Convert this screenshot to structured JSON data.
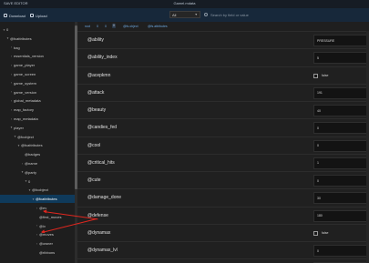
{
  "titlebar": {
    "app_name": "SAVE EDITOR",
    "window_title": "Gamel.mdata"
  },
  "menubar": {
    "download": "Download",
    "upload": "Upload"
  },
  "toolbar": {
    "filter": {
      "value": "All"
    },
    "search": {
      "placeholder": "Search by field or value"
    }
  },
  "breadcrumb": [
    "root",
    "0",
    "0",
    "0",
    "@fs.object",
    "@fs.attributes"
  ],
  "tree": [
    {
      "label": "0",
      "chevron": "v",
      "indent": 0
    },
    {
      "label": "@fcattributes",
      "chevron": "v",
      "indent": 1
    },
    {
      "label": "bag",
      "chevron": ">",
      "indent": 2
    },
    {
      "label": "essentials_version",
      "chevron": ">",
      "indent": 2
    },
    {
      "label": "game_player",
      "chevron": ">",
      "indent": 2
    },
    {
      "label": "game_screen",
      "chevron": ">",
      "indent": 2
    },
    {
      "label": "game_system",
      "chevron": ">",
      "indent": 2
    },
    {
      "label": "game_version",
      "chevron": ">",
      "indent": 2
    },
    {
      "label": "global_metadata",
      "chevron": ">",
      "indent": 2
    },
    {
      "label": "map_factory",
      "chevron": ">",
      "indent": 2
    },
    {
      "label": "map_metadata",
      "chevron": ">",
      "indent": 2
    },
    {
      "label": "player",
      "chevron": "v",
      "indent": 2
    },
    {
      "label": "@fcobject",
      "chevron": "v",
      "indent": 3
    },
    {
      "label": "@fcattributes",
      "chevron": "v",
      "indent": 4
    },
    {
      "label": "@badges",
      "chevron": "",
      "indent": 5
    },
    {
      "label": "@name",
      "chevron": ">",
      "indent": 5
    },
    {
      "label": "@party",
      "chevron": "v",
      "indent": 5
    },
    {
      "label": "0",
      "chevron": "v",
      "indent": 6
    },
    {
      "label": "@fcobject",
      "chevron": "v",
      "indent": 7
    },
    {
      "label": "@fcattributes",
      "chevron": "v",
      "indent": 8,
      "selected": true
    },
    {
      "label": "@ev",
      "chevron": ">",
      "indent": 9
    },
    {
      "label": "@first_moves",
      "chevron": "",
      "indent": 9
    },
    {
      "label": "@iv",
      "chevron": ">",
      "indent": 9
    },
    {
      "label": "@moves",
      "chevron": ">",
      "indent": 9
    },
    {
      "label": "@owner",
      "chevron": ">",
      "indent": 9
    },
    {
      "label": "@ribbons",
      "chevron": "",
      "indent": 9
    }
  ],
  "fields": [
    {
      "label": "@ability",
      "type": "text",
      "value": "PRESSURE"
    },
    {
      "label": "@ability_index",
      "type": "text",
      "value": "5"
    },
    {
      "label": "@acepkmn",
      "type": "bool",
      "value": "false"
    },
    {
      "label": "@attack",
      "type": "text",
      "value": "191"
    },
    {
      "label": "@beauty",
      "type": "text",
      "value": "40"
    },
    {
      "label": "@candies_fed",
      "type": "text",
      "value": "0"
    },
    {
      "label": "@cool",
      "type": "text",
      "value": "0"
    },
    {
      "label": "@critical_hits",
      "type": "text",
      "value": "1"
    },
    {
      "label": "@cute",
      "type": "text",
      "value": "0"
    },
    {
      "label": "@damage_done",
      "type": "text",
      "value": "30"
    },
    {
      "label": "@defense",
      "type": "text",
      "value": "180"
    },
    {
      "label": "@dynamax",
      "type": "bool",
      "value": "false"
    },
    {
      "label": "@dynamax_lvl",
      "type": "text",
      "value": "0"
    },
    {
      "label": "@dynamax_able",
      "type": "text",
      "value": ""
    }
  ],
  "colors": {
    "accent": "#0f3a5b",
    "annotation_arrow": "#e0271f"
  }
}
